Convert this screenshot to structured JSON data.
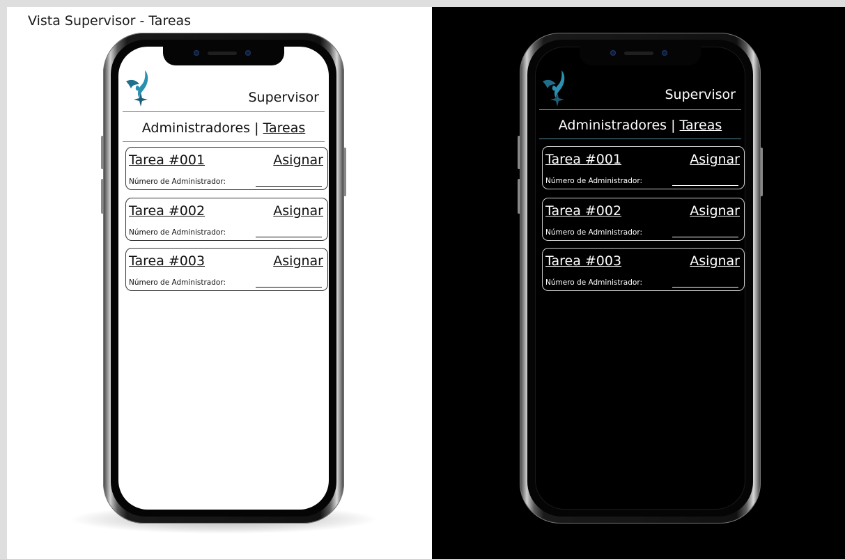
{
  "page_title": "Vista Supervisor - Tareas",
  "colors": {
    "accent": "#2b8fb0",
    "rule": "#5d8fa0",
    "light_bg": "#ffffff",
    "dark_bg": "#000000"
  },
  "icons": {
    "logo": "bird-star-logo-icon"
  },
  "mockups": [
    {
      "theme": "light",
      "role_label": "Supervisor",
      "nav": {
        "admins_label": "Administradores",
        "separator": " | ",
        "tasks_label": "Tareas"
      },
      "tasks": [
        {
          "title": "Tarea #001",
          "assign_label": "Asignar",
          "field_label": "Número de Administrador:"
        },
        {
          "title": "Tarea #002",
          "assign_label": "Asignar",
          "field_label": "Número de Administrador:"
        },
        {
          "title": "Tarea #003",
          "assign_label": "Asignar",
          "field_label": "Número de Administrador:"
        }
      ]
    },
    {
      "theme": "dark",
      "role_label": "Supervisor",
      "nav": {
        "admins_label": "Administradores",
        "separator": " | ",
        "tasks_label": "Tareas"
      },
      "tasks": [
        {
          "title": "Tarea #001",
          "assign_label": "Asignar",
          "field_label": "Número de Administrador:"
        },
        {
          "title": "Tarea #002",
          "assign_label": "Asignar",
          "field_label": "Número de Administrador:"
        },
        {
          "title": "Tarea #003",
          "assign_label": "Asignar",
          "field_label": "Número de Administrador:"
        }
      ]
    }
  ]
}
